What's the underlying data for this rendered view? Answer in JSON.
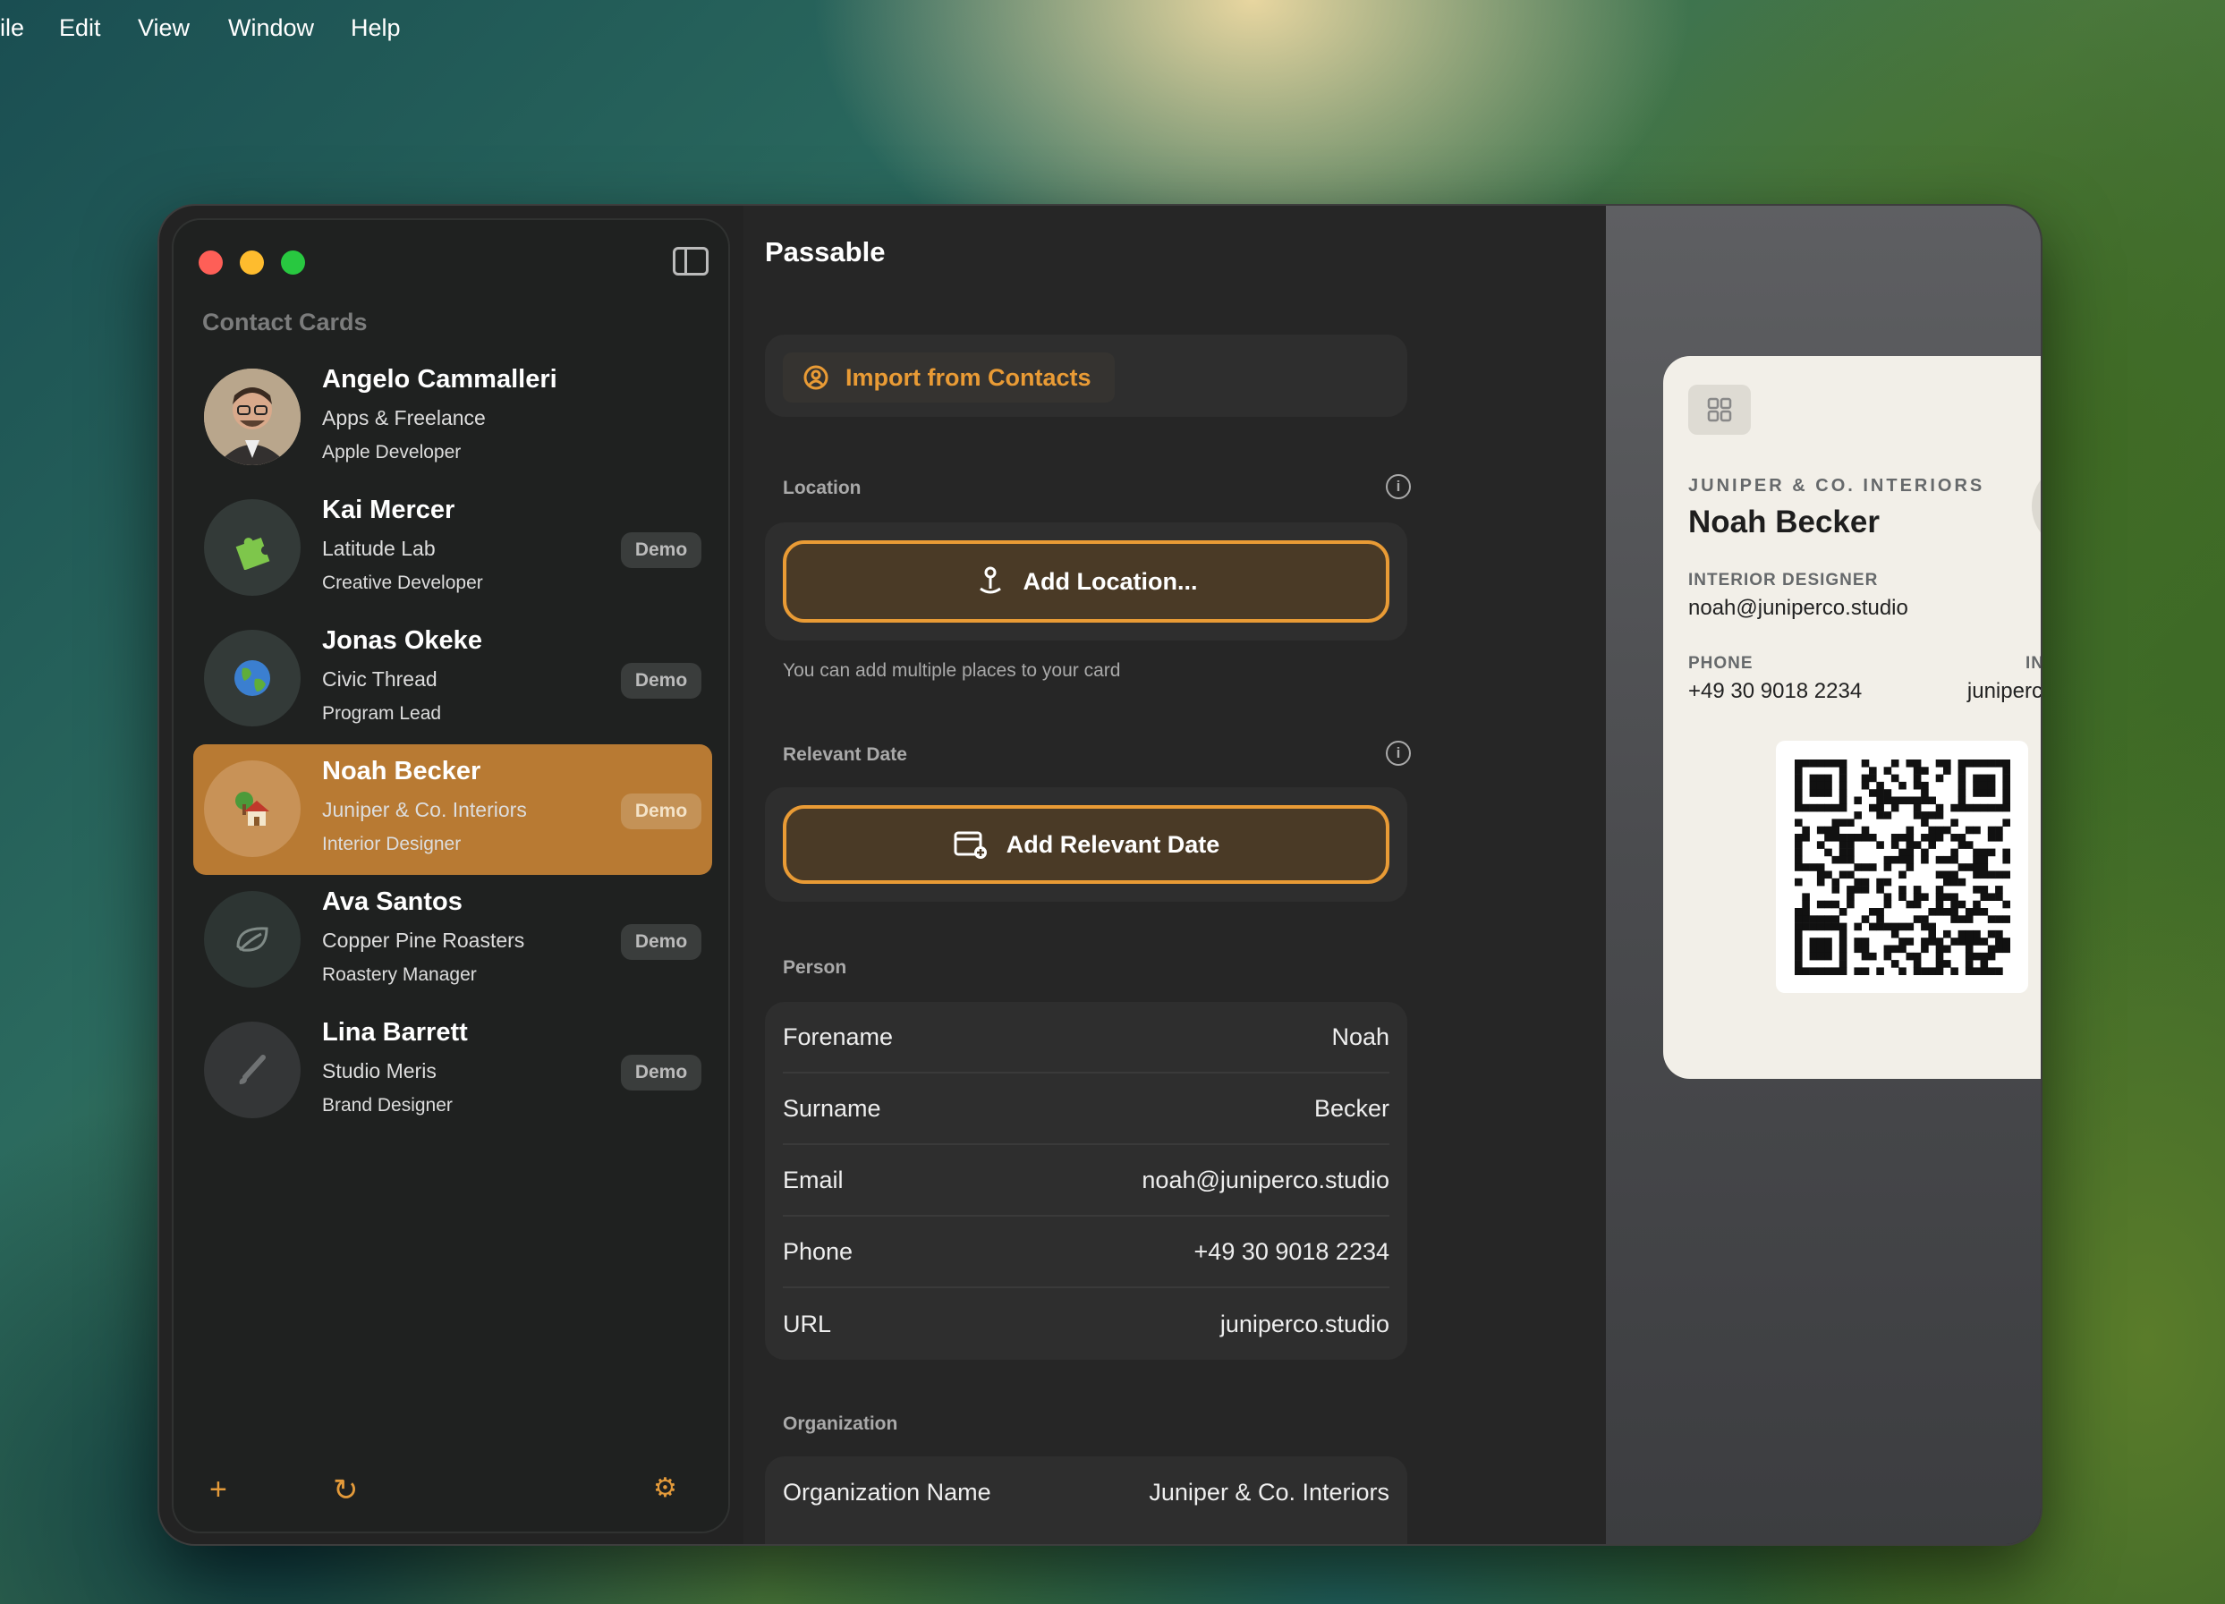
{
  "menubar": {
    "items": [
      "ile",
      "Edit",
      "View",
      "Window",
      "Help"
    ]
  },
  "sidebar": {
    "title": "Contact Cards",
    "contacts": [
      {
        "name": "Angelo Cammalleri",
        "org": "Apps & Freelance",
        "role": "Apple Developer",
        "badge": "",
        "avatar_icon": "person-photo"
      },
      {
        "name": "Kai Mercer",
        "org": "Latitude Lab",
        "role": "Creative Developer",
        "badge": "Demo",
        "avatar_icon": "puzzle-icon"
      },
      {
        "name": "Jonas Okeke",
        "org": "Civic Thread",
        "role": "Program Lead",
        "badge": "Demo",
        "avatar_icon": "globe-icon"
      },
      {
        "name": "Noah Becker",
        "org": "Juniper & Co. Interiors",
        "role": "Interior Designer",
        "badge": "Demo",
        "avatar_icon": "house-icon"
      },
      {
        "name": "Ava Santos",
        "org": "Copper Pine Roasters",
        "role": "Roastery Manager",
        "badge": "Demo",
        "avatar_icon": "leaf-icon"
      },
      {
        "name": "Lina Barrett",
        "org": "Studio Meris",
        "role": "Brand Designer",
        "badge": "Demo",
        "avatar_icon": "brush-icon"
      }
    ],
    "selected": "Noah Becker",
    "footer": {
      "add": "+",
      "refresh": "↻",
      "settings": "⚙"
    }
  },
  "main": {
    "title": "Passable",
    "import_label": "Import from Contacts",
    "location": {
      "label": "Location",
      "button": "Add Location...",
      "hint": "You can add multiple places to your card"
    },
    "relevant_date": {
      "label": "Relevant Date",
      "button": "Add Relevant Date"
    },
    "person": {
      "label": "Person",
      "fields": [
        {
          "key": "Forename",
          "value": "Noah"
        },
        {
          "key": "Surname",
          "value": "Becker"
        },
        {
          "key": "Email",
          "value": "noah@juniperco.studio"
        },
        {
          "key": "Phone",
          "value": "+49 30 9018 2234"
        },
        {
          "key": "URL",
          "value": "juniperco.studio"
        }
      ]
    },
    "organization": {
      "label": "Organization",
      "fields": [
        {
          "key": "Organization Name",
          "value": "Juniper & Co. Interiors"
        }
      ]
    }
  },
  "card": {
    "org": "JUNIPER & CO. INTERIORS",
    "name": "Noah Becker",
    "role_label": "INTERIOR DESIGNER",
    "email": "noah@juniperco.studio",
    "phone_label": "PHONE",
    "phone": "+49 30 9018 2234",
    "internet_label": "INTERNET",
    "internet": "juniperco.studio",
    "logo_icon": "house-icon"
  },
  "colors": {
    "accent": "#e99b35",
    "selected": "#b87a33",
    "close": "#fe5f57",
    "minimize": "#febc2e",
    "zoom": "#28c840"
  }
}
